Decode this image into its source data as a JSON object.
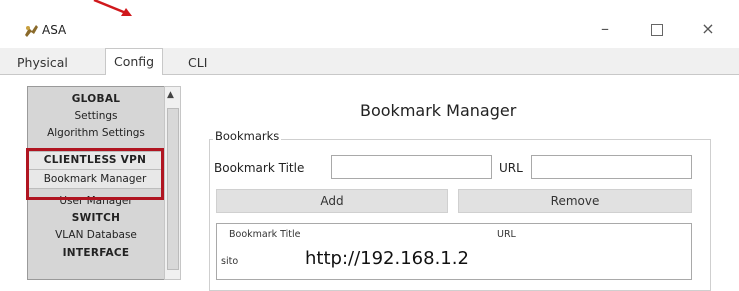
{
  "window": {
    "title": "ASA",
    "controls": {
      "minimize": "–",
      "close": "×"
    }
  },
  "tabs": [
    {
      "label": "Physical"
    },
    {
      "label": "Config",
      "active": true
    },
    {
      "label": "CLI"
    }
  ],
  "nav": {
    "items": [
      {
        "label": "GLOBAL",
        "type": "header"
      },
      {
        "label": "Settings",
        "type": "link"
      },
      {
        "label": "Algorithm Settings",
        "type": "link"
      },
      {
        "label": "CLIENTLESS VPN",
        "type": "header",
        "highlighted": true
      },
      {
        "label": "Bookmark Manager",
        "type": "link",
        "highlighted": true
      },
      {
        "label": "User Manager",
        "type": "link"
      },
      {
        "label": "SWITCH",
        "type": "header"
      },
      {
        "label": "VLAN Database",
        "type": "link"
      },
      {
        "label": "INTERFACE",
        "type": "header"
      }
    ]
  },
  "bookmark_manager": {
    "title": "Bookmark Manager",
    "group_label": "Bookmarks",
    "bookmark_title_label": "Bookmark Title",
    "bookmark_title_value": "",
    "url_label": "URL",
    "url_value": "",
    "add_label": "Add",
    "remove_label": "Remove",
    "table": {
      "columns": [
        "Bookmark Title",
        "URL"
      ],
      "rows": [
        {
          "title": "sito",
          "url": "http://192.168.1.2"
        }
      ]
    }
  },
  "colors": {
    "annotation_red": "#b01521",
    "nav_background": "#d6d6d6",
    "button_background": "#e1e1e1"
  }
}
